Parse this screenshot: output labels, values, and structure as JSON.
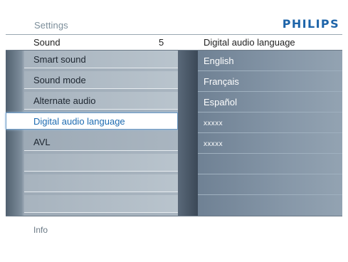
{
  "header": {
    "title": "Settings",
    "brand": "PHILIPS"
  },
  "subheader": {
    "left_label": "Sound",
    "left_value": "5",
    "right_label": "Digital audio language"
  },
  "left_menu": {
    "items": [
      {
        "label": "Smart sound",
        "selected": false
      },
      {
        "label": "Sound mode",
        "selected": false
      },
      {
        "label": "Alternate audio",
        "selected": false
      },
      {
        "label": "Digital audio language",
        "selected": true
      },
      {
        "label": "AVL",
        "selected": false
      },
      {
        "label": "",
        "selected": false
      },
      {
        "label": "",
        "selected": false
      },
      {
        "label": "",
        "selected": false
      }
    ]
  },
  "right_menu": {
    "items": [
      {
        "label": "English"
      },
      {
        "label": "Français"
      },
      {
        "label": "Español"
      },
      {
        "label": "xxxxx"
      },
      {
        "label": "xxxxx"
      },
      {
        "label": ""
      },
      {
        "label": ""
      },
      {
        "label": ""
      }
    ]
  },
  "footer": {
    "info_label": "Info"
  },
  "colors": {
    "brand": "#1d64a9",
    "selected_text": "#1d6bb1",
    "selection_border": "#6f9cc6"
  }
}
